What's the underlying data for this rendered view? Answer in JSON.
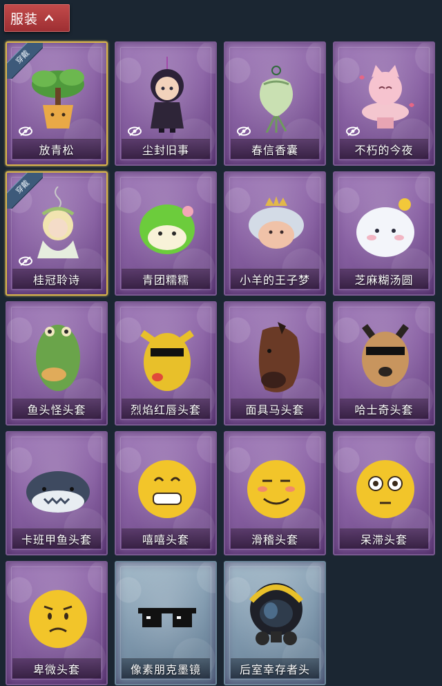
{
  "header": {
    "title": "服装"
  },
  "equipped_label": "穿戴",
  "items": [
    {
      "name": "放青松",
      "equipped": true,
      "hidden": true,
      "style": "purple",
      "art": "pine-bonsai"
    },
    {
      "name": "尘封旧事",
      "equipped": false,
      "hidden": true,
      "style": "purple",
      "art": "chibi-doll"
    },
    {
      "name": "春信香囊",
      "equipped": false,
      "hidden": true,
      "style": "purple",
      "art": "sachet"
    },
    {
      "name": "不朽的今夜",
      "equipped": false,
      "hidden": true,
      "style": "purple",
      "art": "pink-cat-bowl"
    },
    {
      "name": "桂冠聆诗",
      "equipped": true,
      "hidden": true,
      "style": "purple",
      "art": "laurel-charm"
    },
    {
      "name": "青团糯糯",
      "equipped": false,
      "hidden": false,
      "style": "purple",
      "art": "green-dumpling"
    },
    {
      "name": "小羊的王子梦",
      "equipped": false,
      "hidden": false,
      "style": "purple",
      "art": "crowned-sheep"
    },
    {
      "name": "芝麻糊汤圆",
      "equipped": false,
      "hidden": false,
      "style": "purple",
      "art": "white-dumpling"
    },
    {
      "name": "鱼头怪头套",
      "equipped": false,
      "hidden": false,
      "style": "purple",
      "art": "fish-mask"
    },
    {
      "name": "烈焰红唇头套",
      "equipped": false,
      "hidden": false,
      "style": "purple",
      "art": "yellow-mask"
    },
    {
      "name": "面具马头套",
      "equipped": false,
      "hidden": false,
      "style": "purple",
      "art": "horse-mask"
    },
    {
      "name": "哈士奇头套",
      "equipped": false,
      "hidden": false,
      "style": "purple",
      "art": "husky-mask"
    },
    {
      "name": "卡班甲鱼头套",
      "equipped": false,
      "hidden": false,
      "style": "purple",
      "art": "whale-mask"
    },
    {
      "name": "嘻嘻头套",
      "equipped": false,
      "hidden": false,
      "style": "purple",
      "art": "grin-emoji"
    },
    {
      "name": "滑稽头套",
      "equipped": false,
      "hidden": false,
      "style": "purple",
      "art": "smirk-emoji"
    },
    {
      "name": "呆滞头套",
      "equipped": false,
      "hidden": false,
      "style": "purple",
      "art": "stare-emoji"
    },
    {
      "name": "卑微头套",
      "equipped": false,
      "hidden": false,
      "style": "purple",
      "art": "humble-emoji"
    },
    {
      "name": "像素朋克墨镜",
      "equipped": false,
      "hidden": false,
      "style": "blue",
      "art": "pixel-sunglasses"
    },
    {
      "name": "后室幸存者头",
      "equipped": false,
      "hidden": false,
      "style": "blue",
      "art": "gas-mask-helmet"
    }
  ],
  "colors": {
    "background": "#1b2632",
    "card_purple": "#8a62a4",
    "card_blue": "#7f98ad",
    "equipped_border": "#d9b44a",
    "header_red": "#b13c40"
  }
}
